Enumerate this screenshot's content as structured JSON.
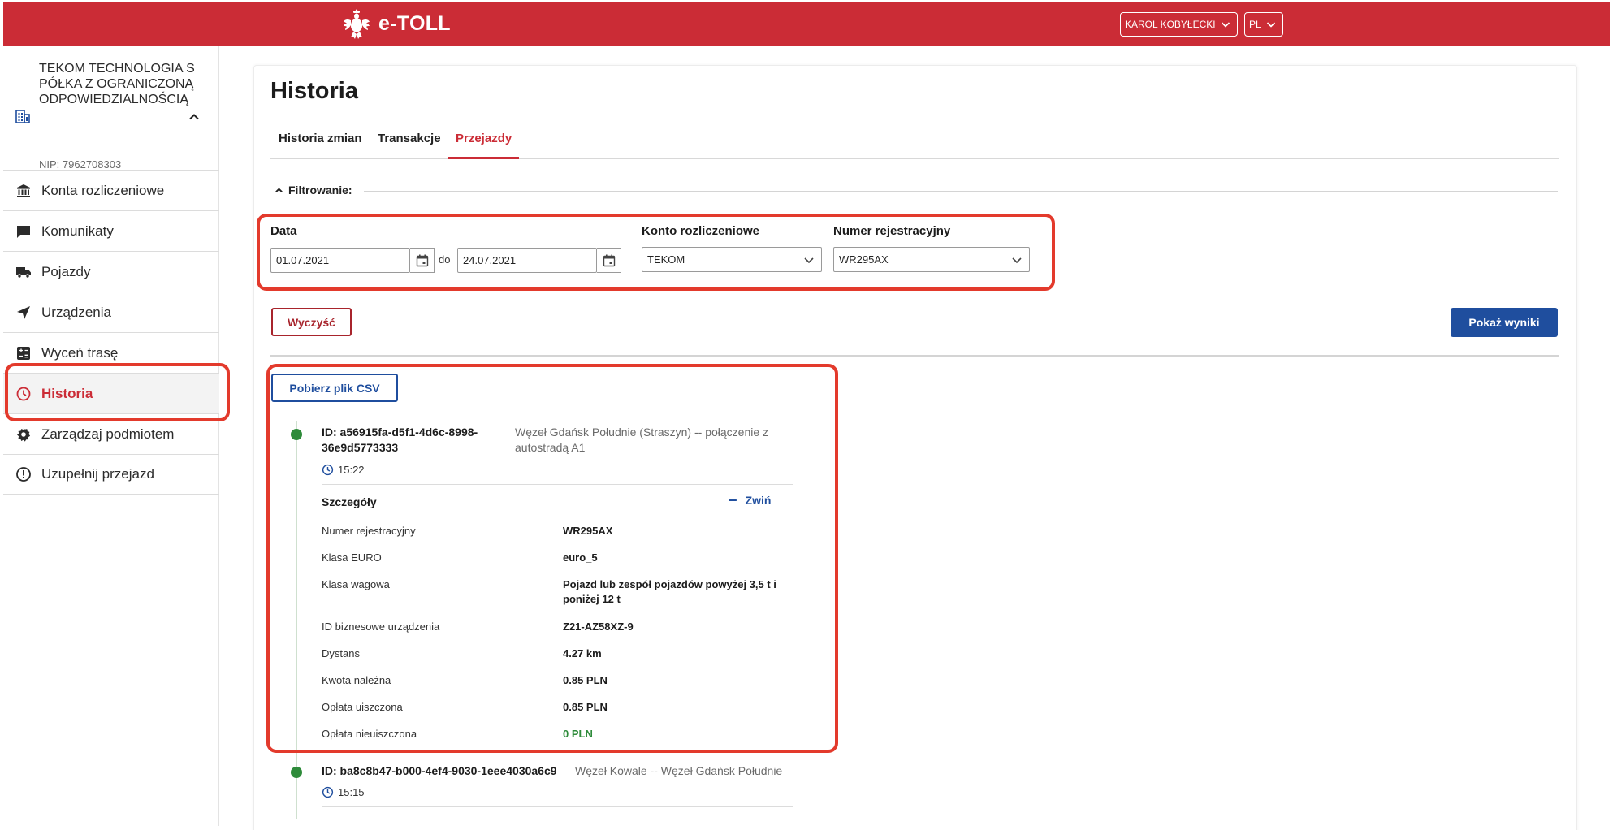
{
  "header": {
    "app_title": "e-TOLL",
    "user_name": "KAROL KOBYŁECKI",
    "language": "PL",
    "colors": {
      "primary_red": "#cb2c36",
      "primary_blue": "#1f4e9e",
      "success_green": "#2e8b3a"
    }
  },
  "sidebar": {
    "company_name": "TEKOM TECHNOLOGIA SPÓŁKA Z OGRANICZONĄ ODPOWIEDZIALNOŚCIĄ",
    "company_nip": "NIP: 7962708303",
    "items": [
      {
        "label": "Konta rozliczeniowe",
        "icon": "bank-icon"
      },
      {
        "label": "Komunikaty",
        "icon": "message-icon"
      },
      {
        "label": "Pojazdy",
        "icon": "truck-icon"
      },
      {
        "label": "Urządzenia",
        "icon": "navigation-icon"
      },
      {
        "label": "Wyceń trasę",
        "icon": "calculator-icon"
      },
      {
        "label": "Historia",
        "icon": "clock-icon",
        "active": true
      },
      {
        "label": "Zarządzaj podmiotem",
        "icon": "gear-icon"
      },
      {
        "label": "Uzupełnij przejazd",
        "icon": "alert-circle-icon"
      }
    ]
  },
  "main": {
    "title": "Historia",
    "tabs": [
      {
        "label": "Historia zmian"
      },
      {
        "label": "Transakcje"
      },
      {
        "label": "Przejazdy",
        "active": true
      }
    ],
    "filter": {
      "heading": "Filtrowanie:",
      "date_label": "Data",
      "date_from": "01.07.2021",
      "date_to_separator": "do",
      "date_to": "24.07.2021",
      "account_label": "Konto rozliczeniowe",
      "account_value": "TEKOM",
      "plate_label": "Numer rejestracyjny",
      "plate_value": "WR295AX",
      "clear_button": "Wyczyść",
      "show_button": "Pokaż wyniki"
    },
    "csv_button": "Pobierz plik CSV",
    "trips": [
      {
        "id": "ID: a56915fa-d5f1-4d6c-8998-36e9d5773333",
        "id_line1": "ID: a56915fa-d5f1-4d6c-8998-",
        "id_line2": "36e9d5773333",
        "route_line1": "Węzeł Gdańsk Południe (Straszyn) -- połączenie z",
        "route_line2": "autostradą A1",
        "time": "15:22",
        "details_title": "Szczegóły",
        "collapse_label": "Zwiń",
        "details": [
          {
            "label": "Numer rejestracyjny",
            "value": "WR295AX"
          },
          {
            "label": "Klasa EURO",
            "value": "euro_5"
          },
          {
            "label": "Klasa wagowa",
            "value": "Pojazd lub zespół pojazdów powyżej 3,5 t i poniżej 12 t"
          },
          {
            "label": "ID biznesowe urządzenia",
            "value": "Z21-AZ58XZ-9"
          },
          {
            "label": "Dystans",
            "value": "4.27 km"
          },
          {
            "label": "Kwota należna",
            "value": "0.85 PLN"
          },
          {
            "label": "Opłata uiszczona",
            "value": "0.85 PLN"
          },
          {
            "label": "Opłata nieuiszczona",
            "value": "0 PLN"
          }
        ]
      },
      {
        "id": "ID: ba8c8b47-b000-4ef4-9030-1eee4030a6c9",
        "route": "Węzeł Kowale -- Węzeł Gdańsk Południe",
        "time": "15:15"
      }
    ]
  }
}
